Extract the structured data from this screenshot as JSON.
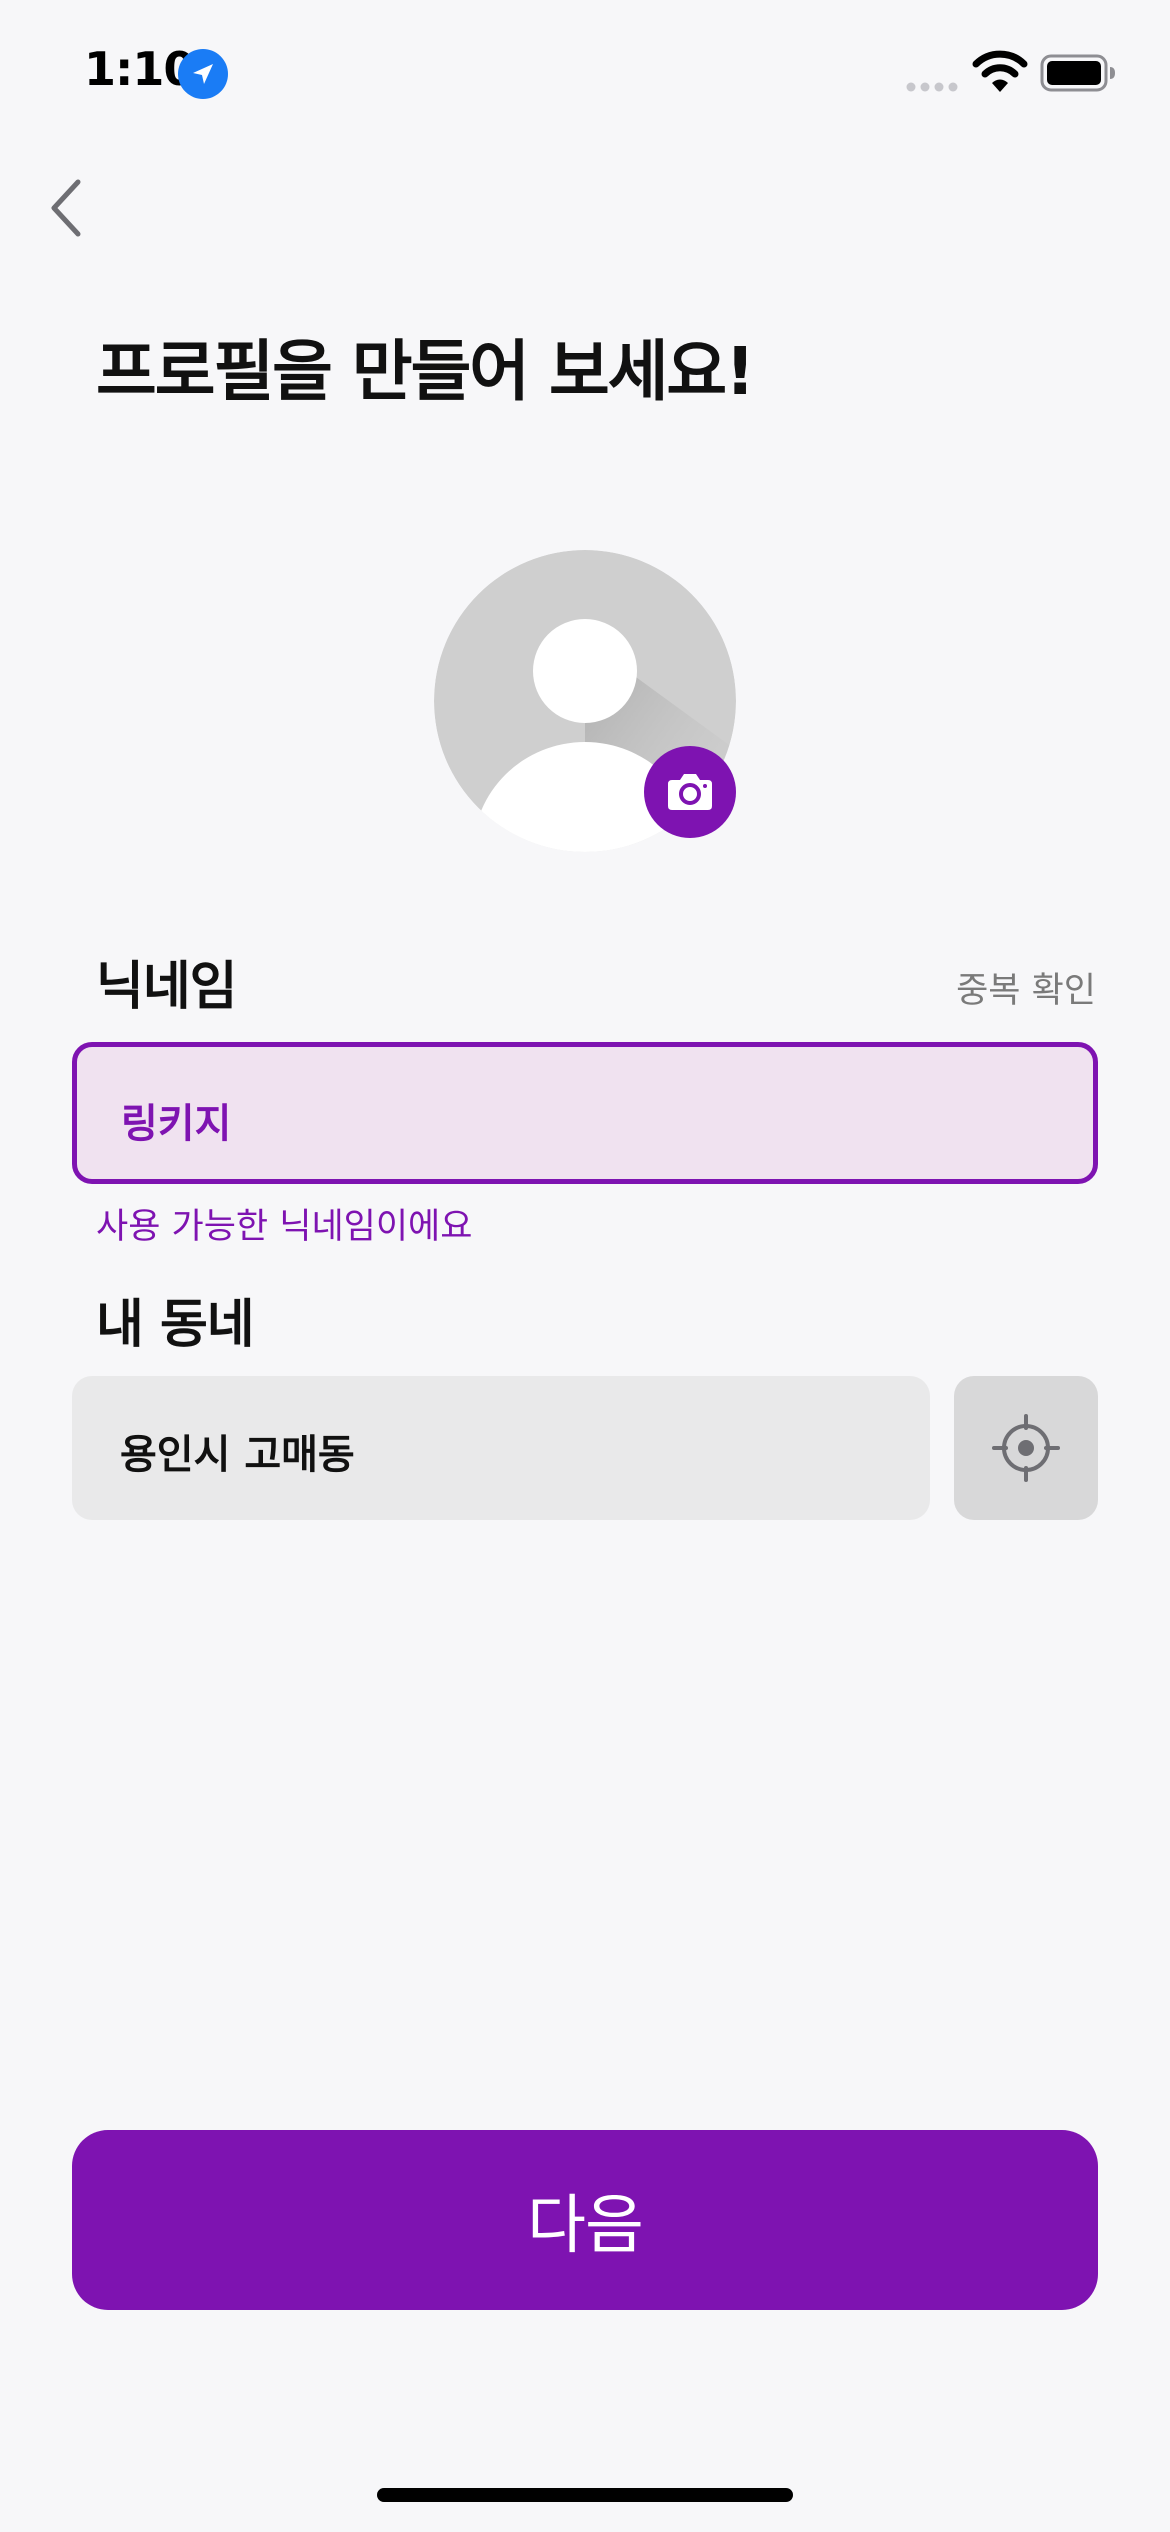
{
  "status_bar": {
    "time": "1:10",
    "icons": [
      "location-arrow-icon",
      "cellular-signal-icon",
      "wifi-icon",
      "battery-icon"
    ]
  },
  "nav": {
    "back_icon": "chevron-left-icon"
  },
  "page": {
    "title": "프로필을 만들어 보세요!"
  },
  "avatar": {
    "placeholder_icon": "person-silhouette-icon",
    "camera_icon": "camera-icon"
  },
  "nickname": {
    "label": "닉네임",
    "duplicate_check_label": "중복 확인",
    "value": "링키지",
    "helper_text": "사용 가능한 닉네임이에요"
  },
  "neighborhood": {
    "label": "내 동네",
    "value": "용인시 고매동",
    "locate_icon": "crosshair-location-icon"
  },
  "footer": {
    "next_label": "다음"
  },
  "colors": {
    "accent": "#7e13b1",
    "accent_light": "#f0e2f0",
    "background": "#f7f7f9",
    "field_gray": "#e9e9ea",
    "button_gray": "#d8d8d9",
    "ios_blue": "#1a7cf5"
  }
}
